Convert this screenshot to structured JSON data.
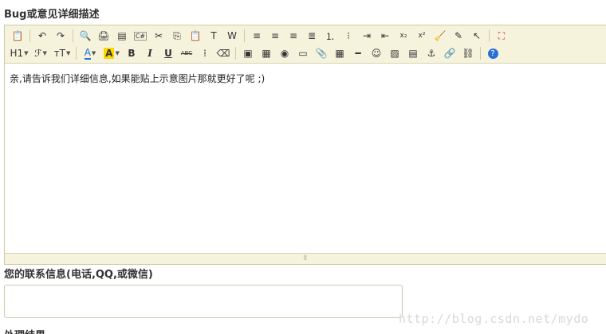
{
  "form": {
    "description_label": "Bug或意见详细描述",
    "contact_label": "您的联系信息(电话,QQ,或微信)",
    "contact_value": "",
    "next_label_cut": "处理结果"
  },
  "editor": {
    "content_text": "亲,请告诉我们详细信息,如果能贴上示意图片那就更好了呢 ;)",
    "toolbar_row1": [
      {
        "name": "source-icon",
        "glyph": "📋"
      },
      {
        "sep": true
      },
      {
        "name": "undo-icon",
        "glyph": "↶"
      },
      {
        "name": "redo-icon",
        "glyph": "↷"
      },
      {
        "sep": true
      },
      {
        "name": "preview-icon",
        "glyph": "🔍"
      },
      {
        "name": "print-icon",
        "glyph": "🖨"
      },
      {
        "name": "template-icon",
        "glyph": "▤"
      },
      {
        "name": "code-icon",
        "glyph": "C#"
      },
      {
        "name": "cut-icon",
        "glyph": "✂"
      },
      {
        "name": "copy-icon",
        "glyph": "⎘"
      },
      {
        "name": "paste-icon",
        "glyph": "📋"
      },
      {
        "name": "paste-text-icon",
        "glyph": "T"
      },
      {
        "name": "paste-word-icon",
        "glyph": "W"
      },
      {
        "sep": true
      },
      {
        "name": "align-left-icon",
        "glyph": "≡"
      },
      {
        "name": "align-center-icon",
        "glyph": "≡"
      },
      {
        "name": "align-right-icon",
        "glyph": "≡"
      },
      {
        "name": "align-justify-icon",
        "glyph": "≣"
      },
      {
        "name": "ordered-list-icon",
        "glyph": "⒈"
      },
      {
        "name": "unordered-list-icon",
        "glyph": "⁝"
      },
      {
        "name": "indent-icon",
        "glyph": "⇥"
      },
      {
        "name": "outdent-icon",
        "glyph": "⇤"
      },
      {
        "name": "subscript-icon",
        "glyph": "x₂"
      },
      {
        "name": "superscript-icon",
        "glyph": "x²"
      },
      {
        "name": "clear-format-icon",
        "glyph": "🧹"
      },
      {
        "name": "quick-format-icon",
        "glyph": "✎"
      },
      {
        "name": "select-all-icon",
        "glyph": "↖"
      },
      {
        "sep": true
      },
      {
        "name": "fullscreen-icon",
        "glyph": "⛶"
      }
    ],
    "toolbar_row2": [
      {
        "name": "heading-icon",
        "glyph": "H1",
        "dropdown": true
      },
      {
        "name": "font-name-icon",
        "glyph": "ℱ",
        "dropdown": true
      },
      {
        "name": "font-size-icon",
        "glyph": "тT",
        "dropdown": true
      },
      {
        "sep": true
      },
      {
        "name": "font-color-icon",
        "glyph": "A",
        "dropdown": true
      },
      {
        "name": "highlight-color-icon",
        "glyph": "A",
        "dropdown": true,
        "highlight": true
      },
      {
        "name": "bold-icon",
        "glyph": "B"
      },
      {
        "name": "italic-icon",
        "glyph": "I"
      },
      {
        "name": "underline-icon",
        "glyph": "U"
      },
      {
        "name": "strikethrough-icon",
        "glyph": "ABC"
      },
      {
        "name": "line-height-icon",
        "glyph": "⁞"
      },
      {
        "name": "eraser-icon",
        "glyph": "⌫"
      },
      {
        "sep": true
      },
      {
        "name": "image-icon",
        "glyph": "▣"
      },
      {
        "name": "multi-image-icon",
        "glyph": "▦"
      },
      {
        "name": "flash-icon",
        "glyph": "◉"
      },
      {
        "name": "media-icon",
        "glyph": "▭"
      },
      {
        "name": "attachment-icon",
        "glyph": "📎"
      },
      {
        "name": "table-icon",
        "glyph": "▦"
      },
      {
        "name": "hr-icon",
        "glyph": "━"
      },
      {
        "name": "emoticon-icon",
        "glyph": "☺"
      },
      {
        "name": "map-icon",
        "glyph": "▨"
      },
      {
        "name": "pagebreak-icon",
        "glyph": "▤"
      },
      {
        "name": "anchor-icon",
        "glyph": "⚓"
      },
      {
        "name": "link-icon",
        "glyph": "🔗"
      },
      {
        "name": "unlink-icon",
        "glyph": "⛓"
      },
      {
        "sep": true
      },
      {
        "name": "help-icon",
        "glyph": "?"
      }
    ]
  },
  "watermark": "http://blog.csdn.net/mydo",
  "colors": {
    "toolbar_bg": "#f6f3dd",
    "border": "#cfcaa4",
    "highlight": "#ffd700",
    "font_color_accent": "#1e6fd6",
    "help_blue": "#2a6fd6"
  }
}
